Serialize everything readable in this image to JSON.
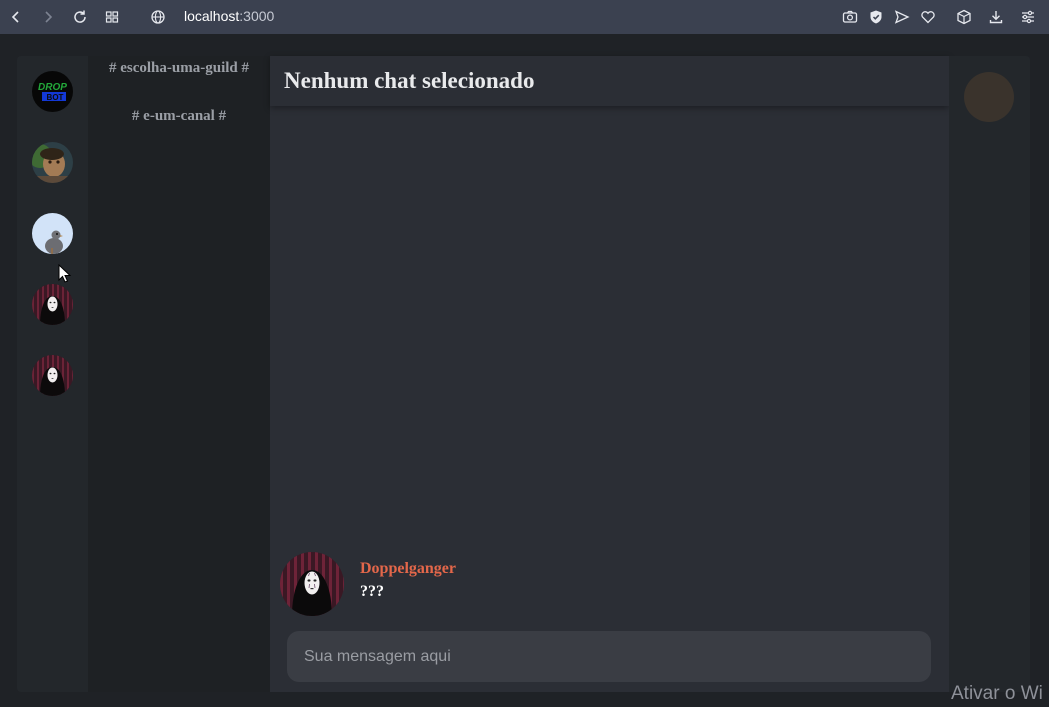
{
  "browser": {
    "url_host": "localhost",
    "url_port": ":3000",
    "icons": [
      "back-icon",
      "forward-icon",
      "reload-icon",
      "tabs-grid-icon",
      "globe-icon",
      "camera-icon",
      "shield-icon",
      "send-icon",
      "heart-icon",
      "cube-icon",
      "download-icon",
      "menu-icon"
    ]
  },
  "servers": [
    {
      "name": "server-dropbot",
      "palette": [
        "#0a0a0a",
        "#1a8f2a",
        "#1034c8"
      ]
    },
    {
      "name": "server-portrait",
      "palette": [
        "#3c5a2e",
        "#a07a52",
        "#2a4256"
      ]
    },
    {
      "name": "server-pigeon",
      "palette": [
        "#cfe0f8",
        "#6d6d70",
        "#9aa0a8"
      ]
    },
    {
      "name": "server-noface-1",
      "palette": [
        "#1a0f14",
        "#7a2238",
        "#f1eeee"
      ]
    },
    {
      "name": "server-noface-2",
      "palette": [
        "#1a0f14",
        "#7a2238",
        "#f1eeee"
      ]
    }
  ],
  "channels": {
    "guild_hint": "# escolha-uma-guild #",
    "channel_hint": "# e-um-canal #"
  },
  "main": {
    "title": "Nenhum chat selecionado"
  },
  "message": {
    "author": "Doppelganger",
    "text": "???",
    "author_color": "#e4674a"
  },
  "input": {
    "placeholder": "Sua mensagem aqui",
    "value": ""
  },
  "watermark": "Ativar o Wi"
}
